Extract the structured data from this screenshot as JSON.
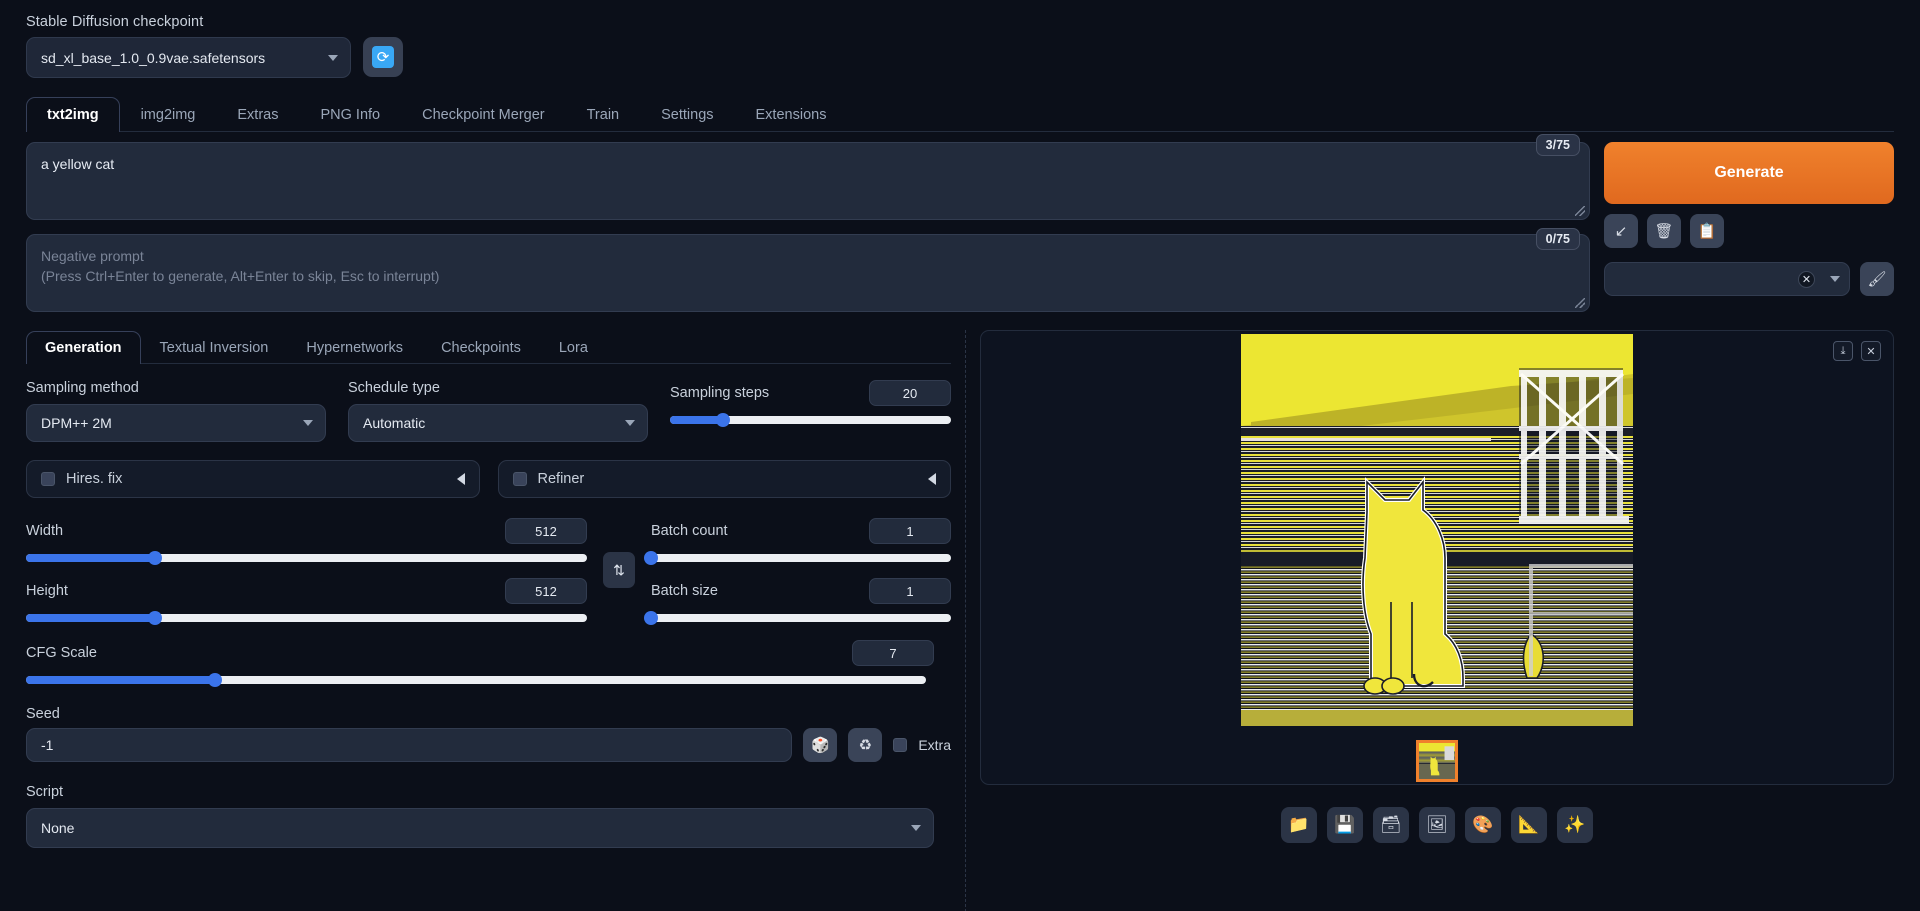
{
  "checkpoint": {
    "label": "Stable Diffusion checkpoint",
    "value": "sd_xl_base_1.0_0.9vae.safetensors",
    "refresh_icon": "refresh-icon"
  },
  "main_tabs": [
    {
      "label": "txt2img",
      "active": true
    },
    {
      "label": "img2img",
      "active": false
    },
    {
      "label": "Extras",
      "active": false
    },
    {
      "label": "PNG Info",
      "active": false
    },
    {
      "label": "Checkpoint Merger",
      "active": false
    },
    {
      "label": "Train",
      "active": false
    },
    {
      "label": "Settings",
      "active": false
    },
    {
      "label": "Extensions",
      "active": false
    }
  ],
  "prompt": {
    "value": "a yellow cat",
    "token_count": "3/75"
  },
  "negative_prompt": {
    "placeholder_line1": "Negative prompt",
    "placeholder_line2": "(Press Ctrl+Enter to generate, Alt+Enter to skip, Esc to interrupt)",
    "value": "",
    "token_count": "0/75"
  },
  "generate": {
    "label": "Generate",
    "small_buttons": [
      {
        "name": "interrupt-arrow-icon",
        "glyph": "↙"
      },
      {
        "name": "trash-icon",
        "glyph": "🗑"
      },
      {
        "name": "clipboard-icon",
        "glyph": "📋"
      }
    ]
  },
  "styles": {
    "value": "",
    "clear_glyph": "✕",
    "edit_icon": "paintbrush-icon",
    "edit_glyph": "🖌"
  },
  "sub_tabs": [
    {
      "label": "Generation",
      "active": true
    },
    {
      "label": "Textual Inversion",
      "active": false
    },
    {
      "label": "Hypernetworks",
      "active": false
    },
    {
      "label": "Checkpoints",
      "active": false
    },
    {
      "label": "Lora",
      "active": false
    }
  ],
  "sampling_method": {
    "label": "Sampling method",
    "value": "DPM++ 2M"
  },
  "schedule_type": {
    "label": "Schedule type",
    "value": "Automatic"
  },
  "sampling_steps": {
    "label": "Sampling steps",
    "value": "20",
    "percent": 19
  },
  "hires_fix": {
    "label": "Hires. fix",
    "checked": false
  },
  "refiner": {
    "label": "Refiner",
    "checked": false
  },
  "width": {
    "label": "Width",
    "value": "512",
    "percent": 23
  },
  "height": {
    "label": "Height",
    "value": "512",
    "percent": 23
  },
  "cfg_scale": {
    "label": "CFG Scale",
    "value": "7",
    "percent": 21
  },
  "batch_count": {
    "label": "Batch count",
    "value": "1",
    "percent": 0
  },
  "batch_size": {
    "label": "Batch size",
    "value": "1",
    "percent": 0
  },
  "swap_button": {
    "name": "swap-dimensions-icon",
    "glyph": "⇅"
  },
  "seed": {
    "label": "Seed",
    "value": "-1",
    "dice_icon": "dice-icon",
    "dice_glyph": "🎲",
    "recycle_icon": "recycle-icon",
    "recycle_glyph": "♻",
    "extra_label": "Extra",
    "extra_checked": false
  },
  "script": {
    "label": "Script",
    "value": "None"
  },
  "gallery": {
    "download_icon": "download-icon",
    "download_glyph": "⤓",
    "close_icon": "close-icon",
    "close_glyph": "✕",
    "image_alt": "a yellow cat"
  },
  "bottom_tools": [
    {
      "name": "open-folder-icon",
      "glyph": "📁"
    },
    {
      "name": "save-icon",
      "glyph": "💾"
    },
    {
      "name": "save-zip-icon",
      "glyph": "🗃"
    },
    {
      "name": "send-to-img2img-icon",
      "glyph": "🖼"
    },
    {
      "name": "send-to-inpaint-icon",
      "glyph": "🎨"
    },
    {
      "name": "send-to-extras-icon",
      "glyph": "📐"
    },
    {
      "name": "sparkles-icon",
      "glyph": "✨"
    }
  ],
  "colors": {
    "accent_orange": "#e8732a",
    "slider_blue": "#3b74ea",
    "background": "#0b0f19",
    "panel": "#222b3c"
  }
}
